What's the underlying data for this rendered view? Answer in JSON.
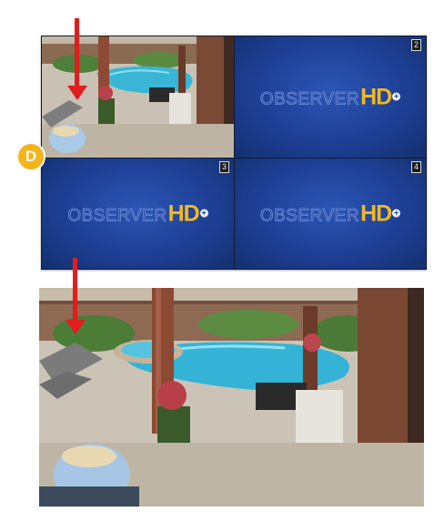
{
  "multiview": {
    "channels": [
      {
        "number": "",
        "type": "camera"
      },
      {
        "number": "2",
        "type": "no-signal"
      },
      {
        "number": "3",
        "type": "no-signal"
      },
      {
        "number": "4",
        "type": "no-signal"
      }
    ],
    "logo": {
      "prefix": "OBSERVER",
      "suffix": "HD",
      "plus": "+"
    }
  },
  "callout": {
    "label": "D"
  },
  "colors": {
    "arrow": "#e11d1d",
    "badge": "#f4b41a",
    "tile_blue": "#1e3f95",
    "logo_yellow": "#f2b81f"
  },
  "icons": {
    "pointer": "down-arrow-icon"
  }
}
